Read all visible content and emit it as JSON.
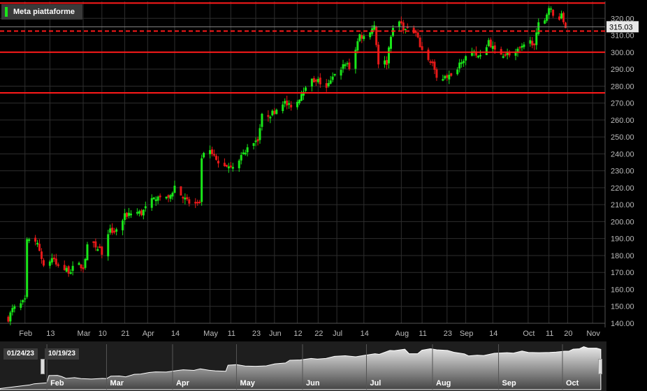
{
  "legend": {
    "label": "Meta piattaforme",
    "color": "#19e619"
  },
  "navigator": {
    "start_label": "01/24/23",
    "end_label": "10/19/23",
    "month_labels": [
      "Feb",
      "Mar",
      "Apr",
      "May",
      "Jun",
      "Jul",
      "Aug",
      "Sep",
      "Oct"
    ]
  },
  "colors": {
    "up": "#19e619",
    "down": "#e61919",
    "level": "#ff1a1a",
    "background": "#000000",
    "grid": "#2e2e2e"
  },
  "chart_data": {
    "type": "candlestick",
    "title": "Meta piattaforme",
    "ylim": [
      140,
      330
    ],
    "yticks": [
      140,
      150,
      160,
      170,
      180,
      190,
      200,
      210,
      220,
      230,
      240,
      250,
      260,
      270,
      280,
      290,
      300,
      310,
      320
    ],
    "ytick_labels": [
      "140.00",
      "150.00",
      "160.00",
      "170.00",
      "180.00",
      "190.00",
      "200.00",
      "210.00",
      "220.00",
      "230.00",
      "240.00",
      "250.00",
      "260.00",
      "270.00",
      "280.00",
      "290.00",
      "300.00",
      "310.00",
      "320.00"
    ],
    "x_range": [
      "2023-01-24",
      "2023-10-19"
    ],
    "x_ticks": [
      {
        "date": "2023-02-01",
        "label": "Feb",
        "major": true
      },
      {
        "date": "2023-02-13",
        "label": "13",
        "major": false
      },
      {
        "date": "2023-03-01",
        "label": "Mar",
        "major": true
      },
      {
        "date": "2023-03-10",
        "label": "10",
        "major": false
      },
      {
        "date": "2023-03-21",
        "label": "21",
        "major": false
      },
      {
        "date": "2023-04-01",
        "label": "Apr",
        "major": true
      },
      {
        "date": "2023-04-14",
        "label": "14",
        "major": false
      },
      {
        "date": "2023-05-01",
        "label": "May",
        "major": true
      },
      {
        "date": "2023-05-11",
        "label": "11",
        "major": false
      },
      {
        "date": "2023-05-23",
        "label": "23",
        "major": false
      },
      {
        "date": "2023-06-01",
        "label": "Jun",
        "major": true
      },
      {
        "date": "2023-06-12",
        "label": "12",
        "major": false
      },
      {
        "date": "2023-06-22",
        "label": "22",
        "major": false
      },
      {
        "date": "2023-07-01",
        "label": "Jul",
        "major": true
      },
      {
        "date": "2023-07-14",
        "label": "14",
        "major": false
      },
      {
        "date": "2023-08-01",
        "label": "Aug",
        "major": true
      },
      {
        "date": "2023-08-11",
        "label": "11",
        "major": false
      },
      {
        "date": "2023-08-23",
        "label": "23",
        "major": false
      },
      {
        "date": "2023-09-01",
        "label": "Sep",
        "major": true
      },
      {
        "date": "2023-09-14",
        "label": "14",
        "major": false
      },
      {
        "date": "2023-10-01",
        "label": "Oct",
        "major": true
      },
      {
        "date": "2023-10-11",
        "label": "11",
        "major": false
      },
      {
        "date": "2023-10-20",
        "label": "20",
        "major": false
      },
      {
        "date": "2023-11-01",
        "label": "Nov",
        "major": true
      }
    ],
    "last_price": 315.03,
    "last_price_label": "315.03",
    "levels": [
      {
        "value": 329,
        "style": "solid"
      },
      {
        "value": 312.5,
        "style": "dashed"
      },
      {
        "value": 300,
        "style": "solid"
      },
      {
        "value": 276,
        "style": "solid"
      }
    ],
    "close_series": [
      {
        "date": "2023-01-24",
        "close": 143
      },
      {
        "date": "2023-01-26",
        "close": 148
      },
      {
        "date": "2023-01-30",
        "close": 151
      },
      {
        "date": "2023-02-01",
        "close": 153
      },
      {
        "date": "2023-02-02",
        "close": 188
      },
      {
        "date": "2023-02-06",
        "close": 189
      },
      {
        "date": "2023-02-08",
        "close": 183
      },
      {
        "date": "2023-02-10",
        "close": 174
      },
      {
        "date": "2023-02-14",
        "close": 178
      },
      {
        "date": "2023-02-17",
        "close": 173
      },
      {
        "date": "2023-02-22",
        "close": 171
      },
      {
        "date": "2023-02-27",
        "close": 174
      },
      {
        "date": "2023-03-01",
        "close": 173
      },
      {
        "date": "2023-03-03",
        "close": 185
      },
      {
        "date": "2023-03-07",
        "close": 186
      },
      {
        "date": "2023-03-10",
        "close": 182
      },
      {
        "date": "2023-03-14",
        "close": 194
      },
      {
        "date": "2023-03-17",
        "close": 195
      },
      {
        "date": "2023-03-21",
        "close": 203
      },
      {
        "date": "2023-03-24",
        "close": 206
      },
      {
        "date": "2023-03-29",
        "close": 205
      },
      {
        "date": "2023-04-03",
        "close": 212
      },
      {
        "date": "2023-04-06",
        "close": 216
      },
      {
        "date": "2023-04-11",
        "close": 213
      },
      {
        "date": "2023-04-14",
        "close": 221
      },
      {
        "date": "2023-04-18",
        "close": 214
      },
      {
        "date": "2023-04-21",
        "close": 211
      },
      {
        "date": "2023-04-26",
        "close": 209
      },
      {
        "date": "2023-04-27",
        "close": 238
      },
      {
        "date": "2023-05-01",
        "close": 241
      },
      {
        "date": "2023-05-05",
        "close": 234
      },
      {
        "date": "2023-05-10",
        "close": 233
      },
      {
        "date": "2023-05-15",
        "close": 235
      },
      {
        "date": "2023-05-19",
        "close": 245
      },
      {
        "date": "2023-05-24",
        "close": 249
      },
      {
        "date": "2023-05-26",
        "close": 262
      },
      {
        "date": "2023-05-31",
        "close": 264
      },
      {
        "date": "2023-06-05",
        "close": 271
      },
      {
        "date": "2023-06-08",
        "close": 268
      },
      {
        "date": "2023-06-12",
        "close": 271
      },
      {
        "date": "2023-06-16",
        "close": 281
      },
      {
        "date": "2023-06-21",
        "close": 284
      },
      {
        "date": "2023-06-26",
        "close": 279
      },
      {
        "date": "2023-06-30",
        "close": 286
      },
      {
        "date": "2023-07-05",
        "close": 294
      },
      {
        "date": "2023-07-07",
        "close": 291
      },
      {
        "date": "2023-07-12",
        "close": 310
      },
      {
        "date": "2023-07-14",
        "close": 309
      },
      {
        "date": "2023-07-19",
        "close": 316
      },
      {
        "date": "2023-07-21",
        "close": 294
      },
      {
        "date": "2023-07-25",
        "close": 294
      },
      {
        "date": "2023-07-27",
        "close": 311
      },
      {
        "date": "2023-07-31",
        "close": 318
      },
      {
        "date": "2023-08-03",
        "close": 313
      },
      {
        "date": "2023-08-08",
        "close": 310
      },
      {
        "date": "2023-08-11",
        "close": 301
      },
      {
        "date": "2023-08-16",
        "close": 293
      },
      {
        "date": "2023-08-18",
        "close": 283
      },
      {
        "date": "2023-08-22",
        "close": 287
      },
      {
        "date": "2023-08-25",
        "close": 285
      },
      {
        "date": "2023-08-30",
        "close": 296
      },
      {
        "date": "2023-09-05",
        "close": 299
      },
      {
        "date": "2023-09-08",
        "close": 297
      },
      {
        "date": "2023-09-12",
        "close": 307
      },
      {
        "date": "2023-09-15",
        "close": 300
      },
      {
        "date": "2023-09-20",
        "close": 299
      },
      {
        "date": "2023-09-25",
        "close": 300
      },
      {
        "date": "2023-09-28",
        "close": 302
      },
      {
        "date": "2023-10-02",
        "close": 306
      },
      {
        "date": "2023-10-04",
        "close": 306
      },
      {
        "date": "2023-10-06",
        "close": 316
      },
      {
        "date": "2023-10-09",
        "close": 318
      },
      {
        "date": "2023-10-11",
        "close": 328
      },
      {
        "date": "2023-10-13",
        "close": 321
      },
      {
        "date": "2023-10-17",
        "close": 321
      },
      {
        "date": "2023-10-19",
        "close": 315
      }
    ]
  }
}
